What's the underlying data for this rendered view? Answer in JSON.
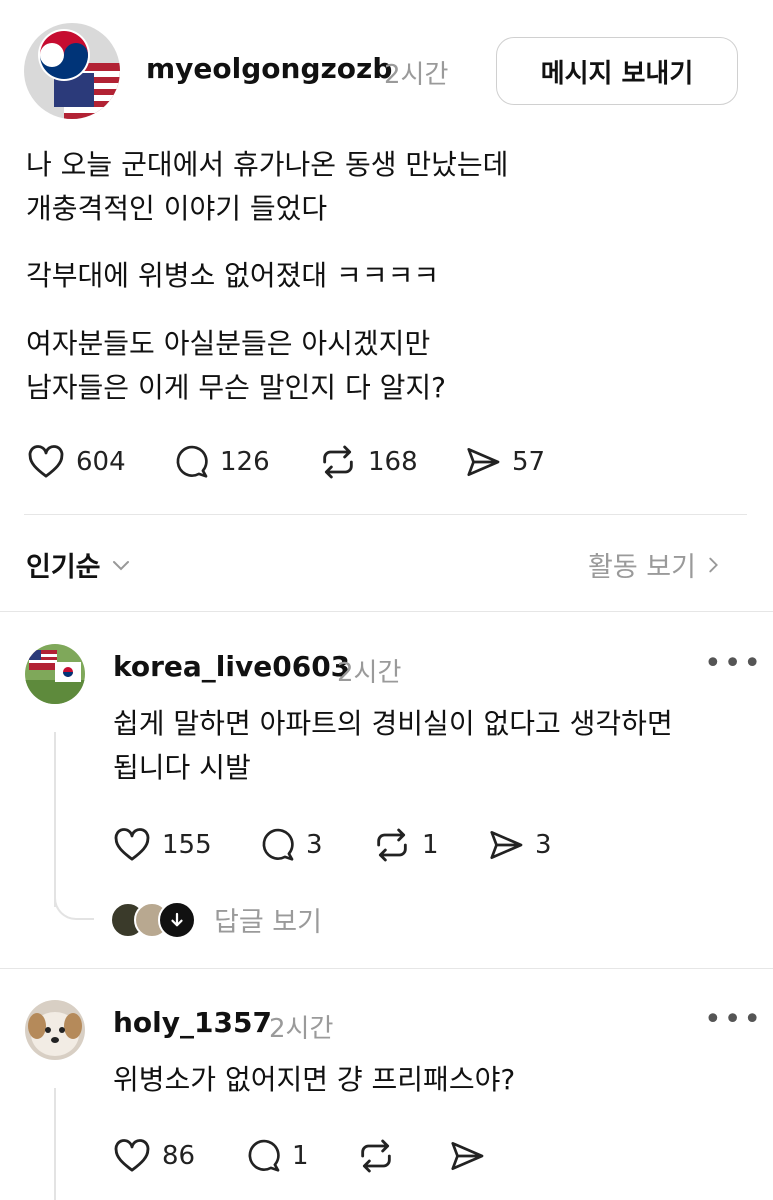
{
  "post": {
    "username": "myeolgongzozb",
    "time": "2시간",
    "message_button": "메시지 보내기",
    "lines": [
      "나 오늘 군대에서 휴가나온 동생 만났는데",
      "개충격적인 이야기 들었다",
      "각부대에 위병소 없어졌대 ㅋㅋㅋㅋ",
      "여자분들도 아실분들은 아시겠지만",
      "남자들은 이게 무슨 말인지 다 알지?"
    ],
    "likes": "604",
    "comments": "126",
    "reposts": "168",
    "shares": "57"
  },
  "sort": {
    "label": "인기순",
    "activity_label": "활동 보기"
  },
  "replies": [
    {
      "username": "korea_live0603",
      "time": "2시간",
      "lines": [
        "쉽게 말하면 아파트의 경비실이 없다고 생각하면",
        "됩니다 시발"
      ],
      "likes": "155",
      "comments": "3",
      "reposts": "1",
      "shares": "3",
      "view_replies": "답글 보기"
    },
    {
      "username": "holy_1357",
      "time": "2시간",
      "lines": [
        "위병소가 없어지면 걍 프리패스야?"
      ],
      "likes": "86",
      "comments": "1"
    }
  ],
  "colors": {
    "text": "#111111",
    "muted": "#9a9a9a",
    "divider": "#e6e6e6"
  },
  "icons": [
    "heart-icon",
    "comment-icon",
    "repost-icon",
    "send-icon",
    "chevron-down-icon",
    "chevron-right-icon",
    "more-icon",
    "arrow-down-icon"
  ]
}
